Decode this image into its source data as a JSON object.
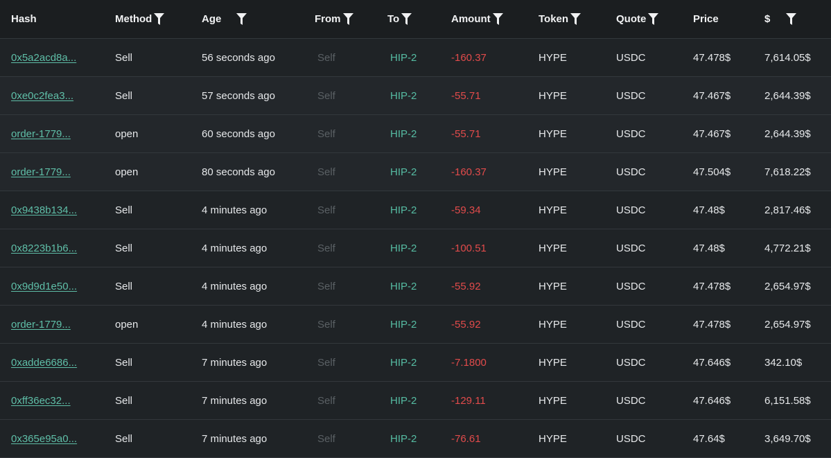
{
  "columns": {
    "hash": "Hash",
    "method": "Method",
    "age": "Age",
    "from": "From",
    "to": "To",
    "amount": "Amount",
    "token": "Token",
    "quote": "Quote",
    "price": "Price",
    "usd": "$"
  },
  "icons": {
    "filter": "filter-icon"
  },
  "colors": {
    "link": "#5fbfa8",
    "to": "#56bca3",
    "negative": "#e24b4b",
    "muted": "#5a6064"
  },
  "rows": [
    {
      "hash": "0x5a2acd8a...",
      "method": "Sell",
      "age": "56 seconds ago",
      "from": "Self",
      "to": "HIP-2",
      "amount": "-160.37",
      "token": "HYPE",
      "quote": "USDC",
      "price": "47.478$",
      "usd": "7,614.05$"
    },
    {
      "hash": "0xe0c2fea3...",
      "method": "Sell",
      "age": "57 seconds ago",
      "from": "Self",
      "to": "HIP-2",
      "amount": "-55.71",
      "token": "HYPE",
      "quote": "USDC",
      "price": "47.467$",
      "usd": "2,644.39$"
    },
    {
      "hash": "order-1779...",
      "method": "open",
      "age": "60 seconds ago",
      "from": "Self",
      "to": "HIP-2",
      "amount": "-55.71",
      "token": "HYPE",
      "quote": "USDC",
      "price": "47.467$",
      "usd": "2,644.39$"
    },
    {
      "hash": "order-1779...",
      "method": "open",
      "age": "80 seconds ago",
      "from": "Self",
      "to": "HIP-2",
      "amount": "-160.37",
      "token": "HYPE",
      "quote": "USDC",
      "price": "47.504$",
      "usd": "7,618.22$"
    },
    {
      "hash": "0x9438b134...",
      "method": "Sell",
      "age": "4 minutes ago",
      "from": "Self",
      "to": "HIP-2",
      "amount": "-59.34",
      "token": "HYPE",
      "quote": "USDC",
      "price": "47.48$",
      "usd": "2,817.46$"
    },
    {
      "hash": "0x8223b1b6...",
      "method": "Sell",
      "age": "4 minutes ago",
      "from": "Self",
      "to": "HIP-2",
      "amount": "-100.51",
      "token": "HYPE",
      "quote": "USDC",
      "price": "47.48$",
      "usd": "4,772.21$"
    },
    {
      "hash": "0x9d9d1e50...",
      "method": "Sell",
      "age": "4 minutes ago",
      "from": "Self",
      "to": "HIP-2",
      "amount": "-55.92",
      "token": "HYPE",
      "quote": "USDC",
      "price": "47.478$",
      "usd": "2,654.97$"
    },
    {
      "hash": "order-1779...",
      "method": "open",
      "age": "4 minutes ago",
      "from": "Self",
      "to": "HIP-2",
      "amount": "-55.92",
      "token": "HYPE",
      "quote": "USDC",
      "price": "47.478$",
      "usd": "2,654.97$"
    },
    {
      "hash": "0xadde6686...",
      "method": "Sell",
      "age": "7 minutes ago",
      "from": "Self",
      "to": "HIP-2",
      "amount": "-7.1800",
      "token": "HYPE",
      "quote": "USDC",
      "price": "47.646$",
      "usd": "342.10$"
    },
    {
      "hash": "0xff36ec32...",
      "method": "Sell",
      "age": "7 minutes ago",
      "from": "Self",
      "to": "HIP-2",
      "amount": "-129.11",
      "token": "HYPE",
      "quote": "USDC",
      "price": "47.646$",
      "usd": "6,151.58$"
    },
    {
      "hash": "0x365e95a0...",
      "method": "Sell",
      "age": "7 minutes ago",
      "from": "Self",
      "to": "HIP-2",
      "amount": "-76.61",
      "token": "HYPE",
      "quote": "USDC",
      "price": "47.64$",
      "usd": "3,649.70$"
    }
  ]
}
